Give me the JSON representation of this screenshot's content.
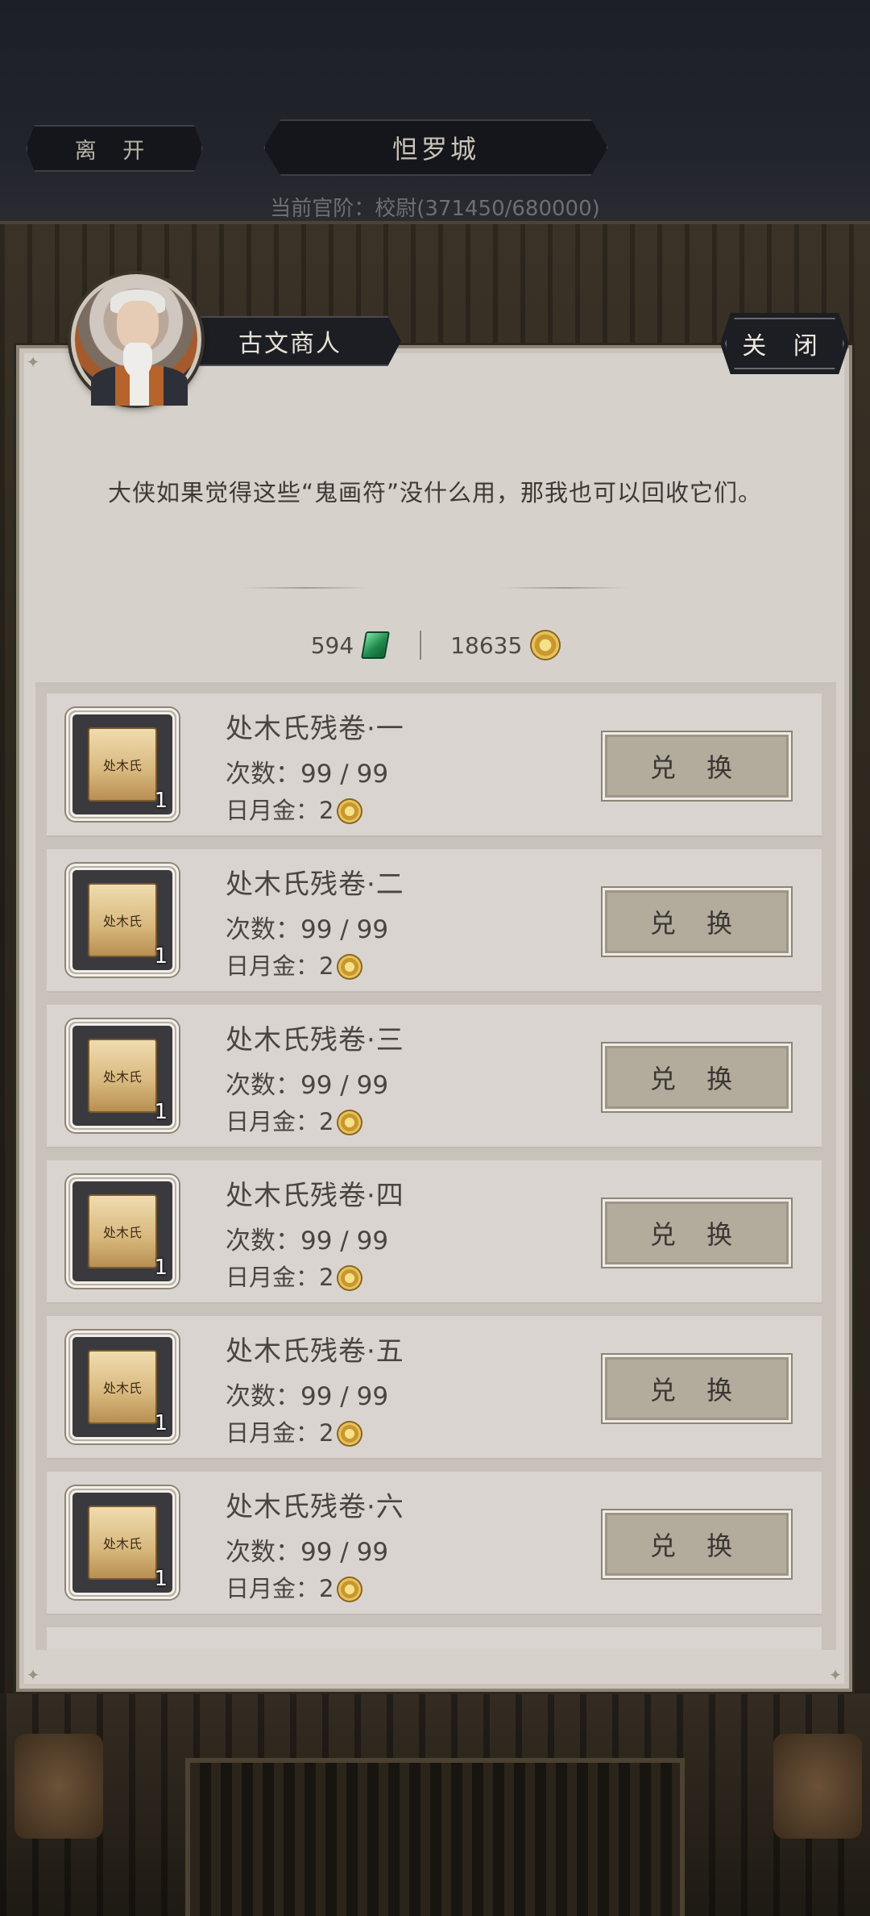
{
  "header": {
    "leave_label": "离 开",
    "city_name": "怛罗城",
    "rank_text": "当前官阶：校尉(371450/680000)"
  },
  "dialog": {
    "npc_name": "古文商人",
    "close_label": "关 闭",
    "message": "大侠如果觉得这些“鬼画符”没什么用，那我也可以回收它们。"
  },
  "currency": {
    "jade_amount": "594",
    "gold_amount": "18635",
    "jade_icon": "jade-icon",
    "gold_icon": "sun-moon-gold-coin-icon"
  },
  "items": [
    {
      "name": "处木氏残卷·一",
      "times": "次数：99 / 99",
      "price_label": "日月金：2",
      "count": "1",
      "exchange_label": "兑 换",
      "scroll_text": "处木氏"
    },
    {
      "name": "处木氏残卷·二",
      "times": "次数：99 / 99",
      "price_label": "日月金：2",
      "count": "1",
      "exchange_label": "兑 换",
      "scroll_text": "处木氏"
    },
    {
      "name": "处木氏残卷·三",
      "times": "次数：99 / 99",
      "price_label": "日月金：2",
      "count": "1",
      "exchange_label": "兑 换",
      "scroll_text": "处木氏"
    },
    {
      "name": "处木氏残卷·四",
      "times": "次数：99 / 99",
      "price_label": "日月金：2",
      "count": "1",
      "exchange_label": "兑 换",
      "scroll_text": "处木氏"
    },
    {
      "name": "处木氏残卷·五",
      "times": "次数：99 / 99",
      "price_label": "日月金：2",
      "count": "1",
      "exchange_label": "兑 换",
      "scroll_text": "处木氏"
    },
    {
      "name": "处木氏残卷·六",
      "times": "次数：99 / 99",
      "price_label": "日月金：2",
      "count": "1",
      "exchange_label": "兑 换",
      "scroll_text": "处木氏"
    }
  ]
}
